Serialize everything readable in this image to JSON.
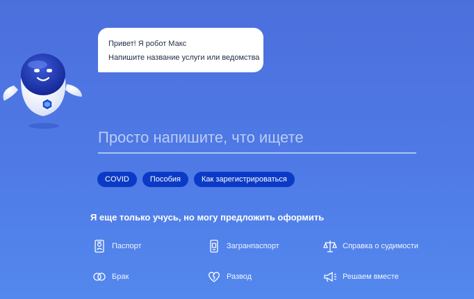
{
  "assistant": {
    "greeting": "Привет! Я робот Макс",
    "prompt": "Напишите название услуги или ведомства"
  },
  "search": {
    "placeholder": "Просто напишите, что ищете",
    "value": ""
  },
  "quick_tags": [
    "COVID",
    "Пособия",
    "Как зарегистрироваться"
  ],
  "suggestions": {
    "title": "Я еще только учусь, но могу предложить оформить",
    "items": [
      {
        "label": "Паспорт",
        "icon": "passport-icon"
      },
      {
        "label": "Загранпаспорт",
        "icon": "foreign-passport-icon"
      },
      {
        "label": "Справка о судимости",
        "icon": "scales-icon"
      },
      {
        "label": "Брак",
        "icon": "rings-icon"
      },
      {
        "label": "Развод",
        "icon": "broken-heart-icon"
      },
      {
        "label": "Решаем вместе",
        "icon": "megaphone-icon"
      }
    ]
  },
  "colors": {
    "background": "#4f7ae6",
    "chip": "#0b3bc6",
    "bubble": "#ffffff"
  }
}
